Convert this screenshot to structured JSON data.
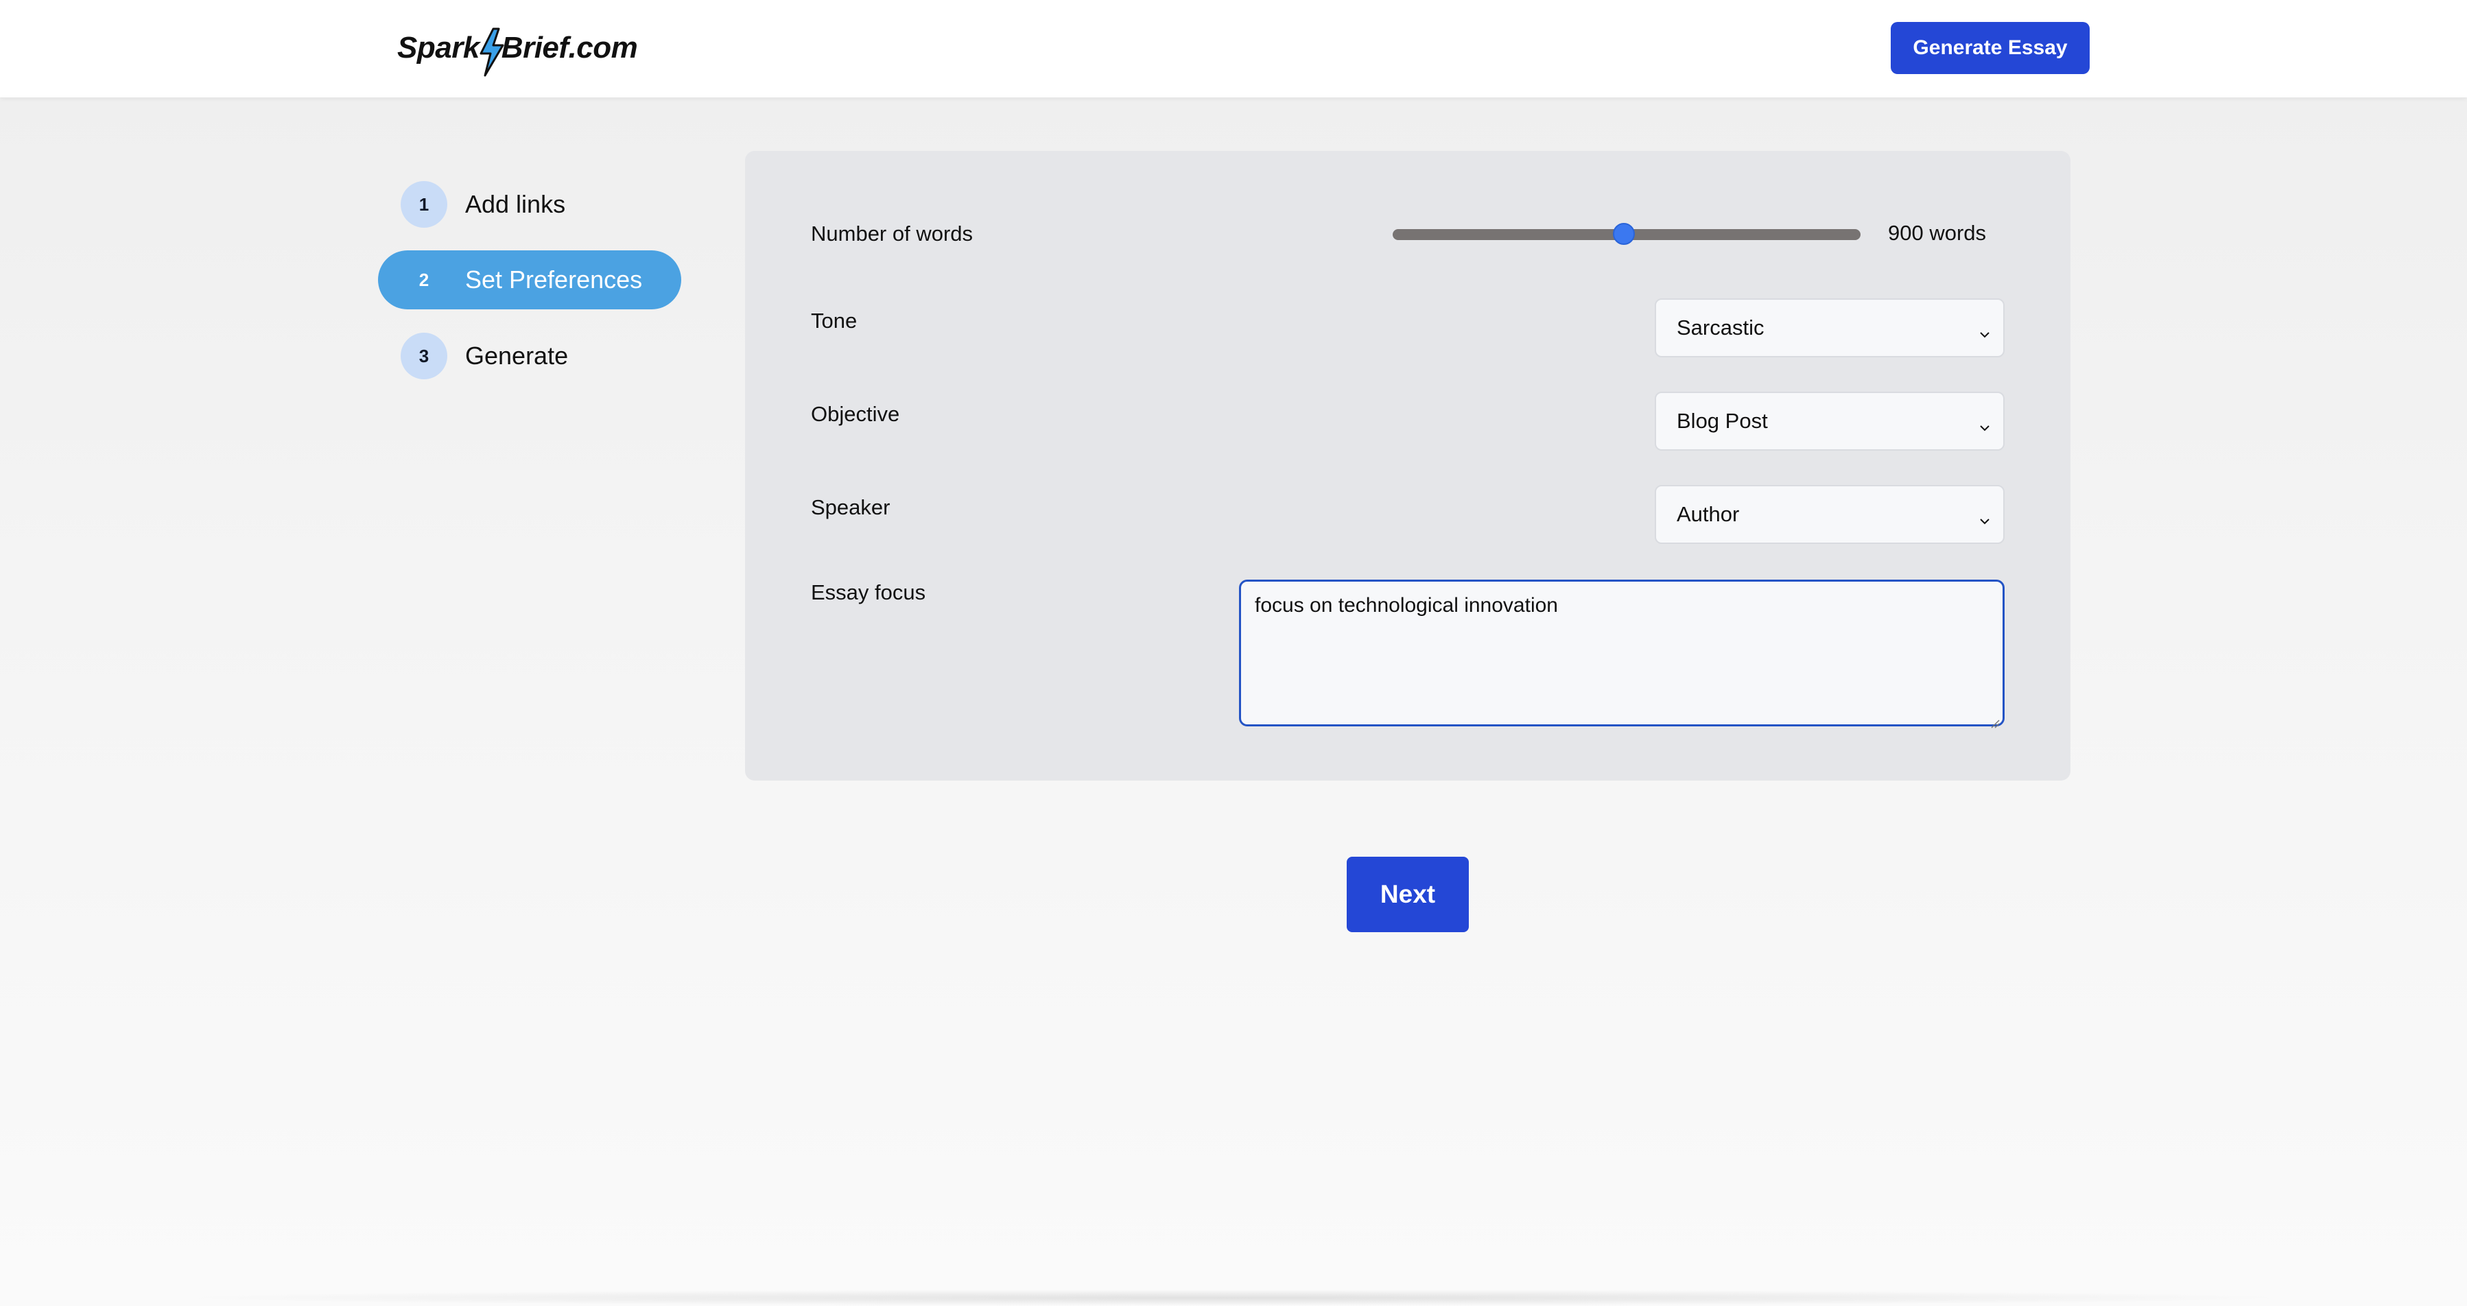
{
  "header": {
    "logo_text_left": "Spark",
    "logo_text_right": "Brief.com",
    "logo_icon": "lightning-bolt-icon",
    "generate_button_label": "Generate Essay"
  },
  "steps": [
    {
      "number": "1",
      "label": "Add links",
      "active": false
    },
    {
      "number": "2",
      "label": "Set Preferences",
      "active": true
    },
    {
      "number": "3",
      "label": "Generate",
      "active": false
    }
  ],
  "preferences": {
    "words": {
      "label": "Number of words",
      "value_text": "900 words",
      "value_fraction": 0.5
    },
    "tone": {
      "label": "Tone",
      "selected": "Sarcastic"
    },
    "objective": {
      "label": "Objective",
      "selected": "Blog Post"
    },
    "speaker": {
      "label": "Speaker",
      "selected": "Author"
    },
    "focus": {
      "label": "Essay focus",
      "value": "focus on technological innovation"
    }
  },
  "actions": {
    "next_label": "Next"
  },
  "colors": {
    "primary": "#2447d6",
    "active_step": "#4ba2e2",
    "step_circle": "#c9dcf7",
    "slider_thumb": "#3b78f0",
    "panel_bg": "#e5e6e9"
  }
}
